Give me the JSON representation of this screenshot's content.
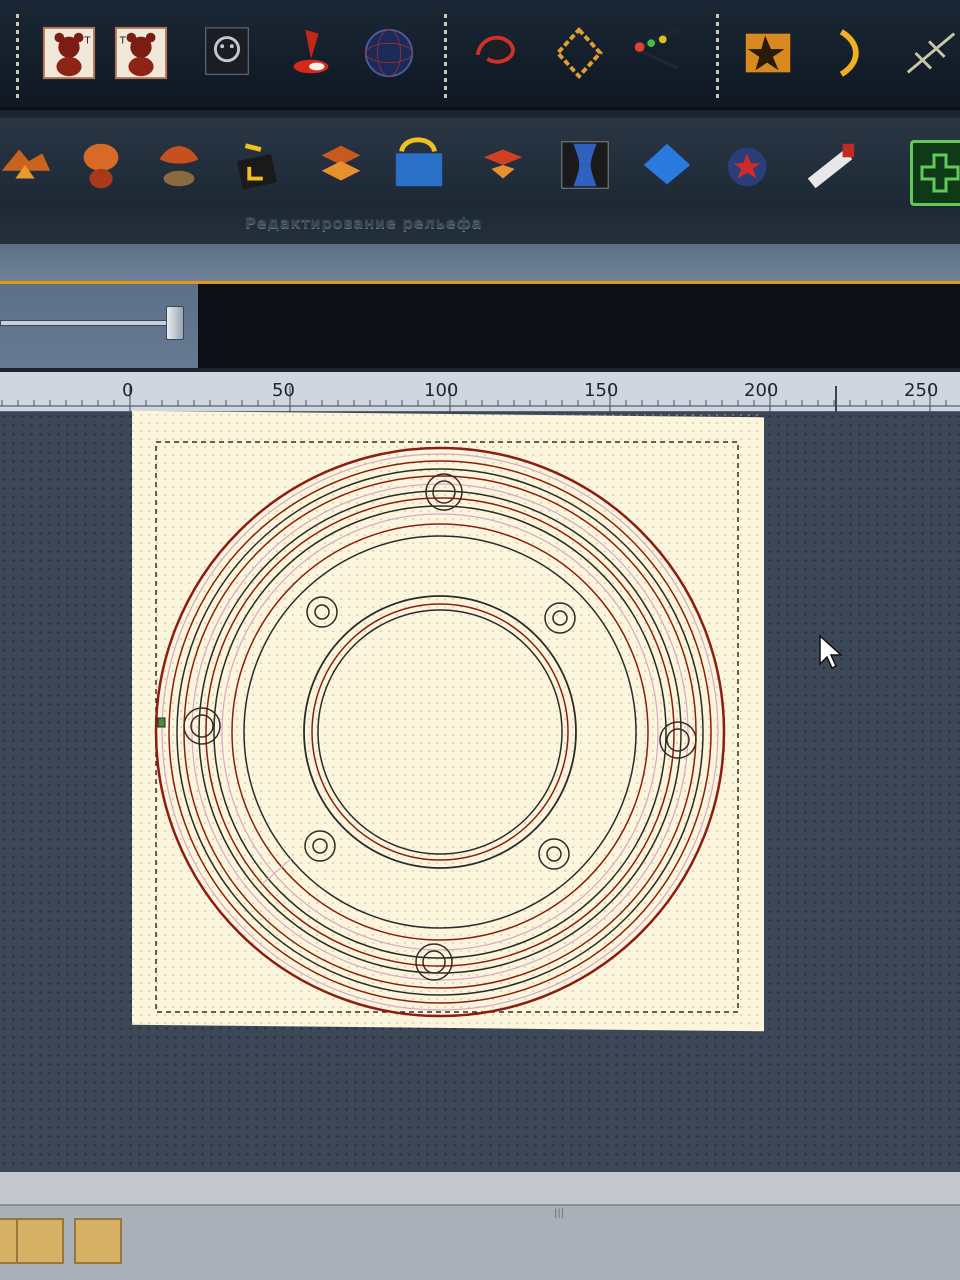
{
  "toolbar_top": {
    "items": [
      {
        "icon": "bear-relief-text-icon"
      },
      {
        "icon": "bear-relief-icon"
      },
      {
        "icon": "smiley-mask-icon"
      },
      {
        "icon": "red-stamp-icon"
      },
      {
        "icon": "globe-mesh-icon"
      },
      {
        "icon": "node-link-icon"
      },
      {
        "icon": "diamond-vector-icon"
      },
      {
        "icon": "scissors-vector-icon"
      },
      {
        "icon": "orange-star-box-icon"
      },
      {
        "icon": "arc-bracket-icon"
      },
      {
        "icon": "spline-edit-icon"
      }
    ]
  },
  "toolbar_relief": {
    "group_label": "Редактирование рельефа",
    "items": [
      {
        "icon": "relief-peak-icon"
      },
      {
        "icon": "relief-dome-icon"
      },
      {
        "icon": "relief-sculpt-icon"
      },
      {
        "icon": "relief-smooth-icon"
      },
      {
        "icon": "relief-layer-icon"
      },
      {
        "icon": "relief-bend-icon"
      },
      {
        "icon": "relief-warp-icon"
      },
      {
        "icon": "relief-wrap-icon"
      },
      {
        "icon": "relief-plane-icon"
      },
      {
        "icon": "relief-stamp-icon"
      },
      {
        "icon": "relief-saw-icon"
      },
      {
        "icon": "add-plus-icon"
      }
    ]
  },
  "ruler": {
    "labels": [
      "0",
      "50",
      "100",
      "150",
      "200",
      "250"
    ]
  },
  "colors": {
    "sheet": "#fbf5dc",
    "vector_dark": "#2b2a2a",
    "vector_red": "#8a1d14",
    "vector_pink": "#d9a6c8",
    "accent_orange": "#e09a18"
  }
}
